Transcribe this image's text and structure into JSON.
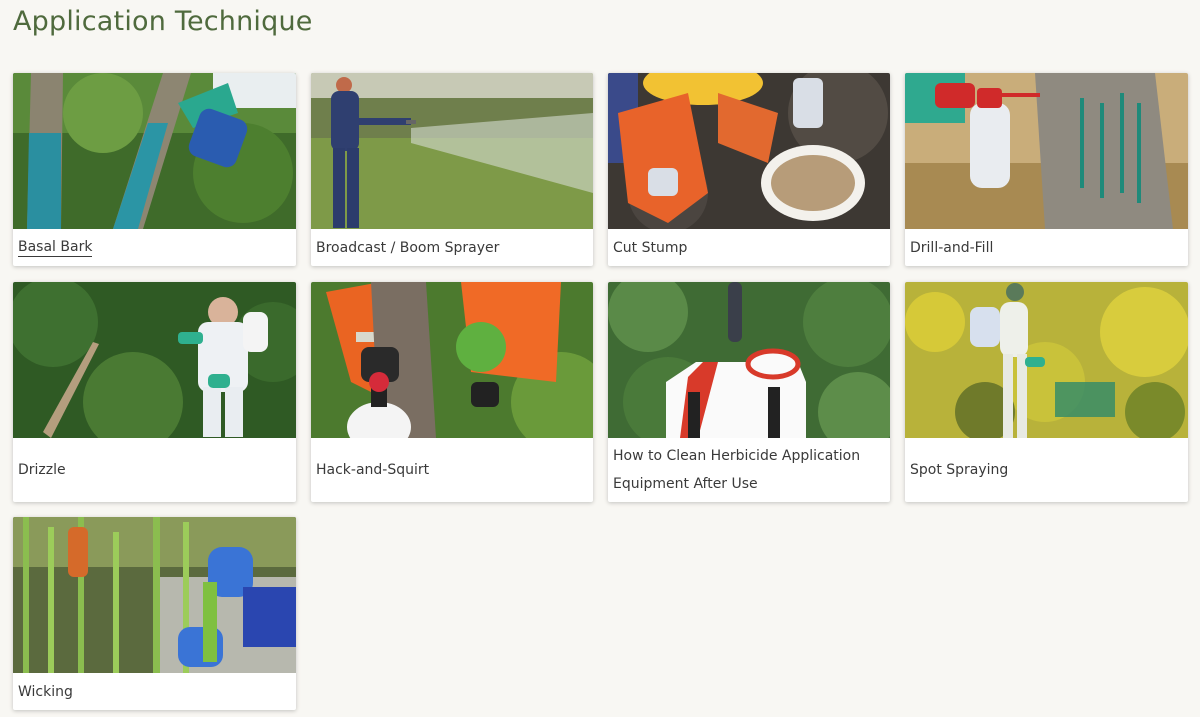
{
  "page": {
    "title": "Application Technique"
  },
  "cards": [
    {
      "label": "Basal Bark"
    },
    {
      "label": "Broadcast / Boom Sprayer"
    },
    {
      "label": "Cut Stump"
    },
    {
      "label": "Drill-and-Fill"
    },
    {
      "label": "Drizzle"
    },
    {
      "label": "Hack-and-Squirt"
    },
    {
      "label": "How to Clean Herbicide Application Equipment After Use"
    },
    {
      "label": "Spot Spraying"
    },
    {
      "label": "Wicking"
    }
  ],
  "colors": {
    "title": "#4f6a3d",
    "background": "#f8f7f3",
    "card": "#ffffff"
  }
}
